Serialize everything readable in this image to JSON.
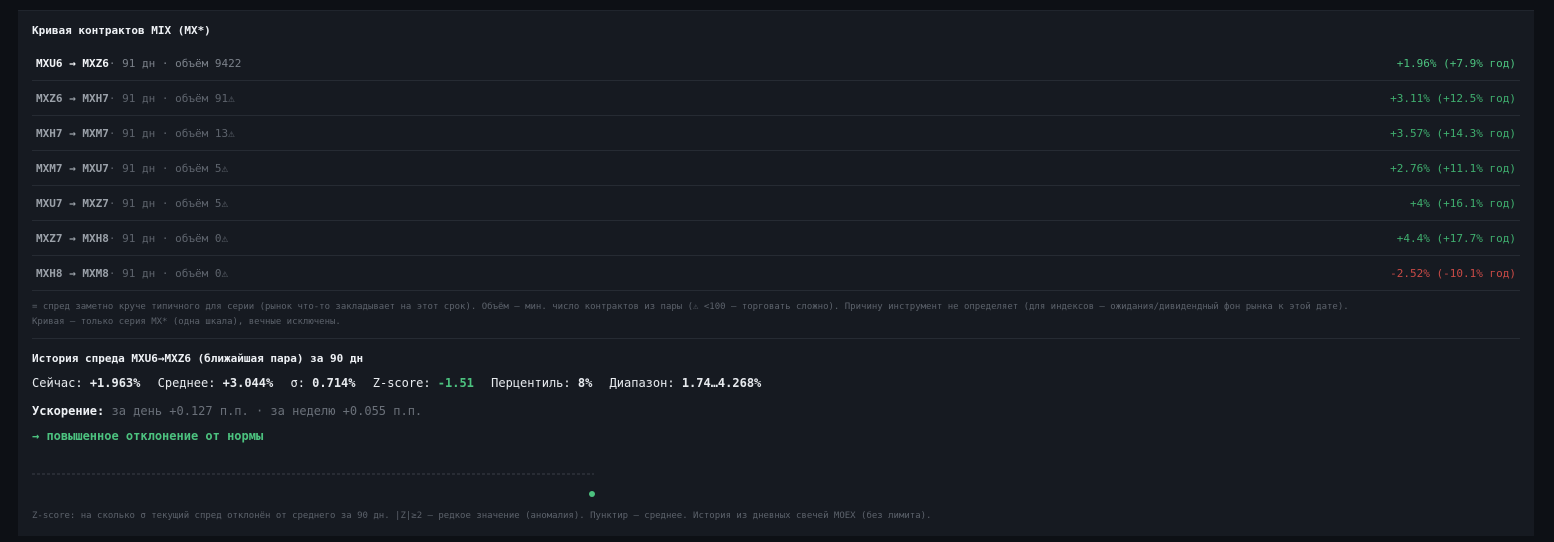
{
  "curve": {
    "title": "Кривая контрактов MIX (MX*)",
    "rows": [
      {
        "pair": "MXU6 → MXZ6",
        "meta": " · 91 дн · объём 9422",
        "pct": "+1.96% (+7.9% год)"
      },
      {
        "pair": "MXZ6 → MXH7",
        "meta": " · 91 дн · объём 91⚠",
        "pct": "+3.11% (+12.5% год)"
      },
      {
        "pair": "MXH7 → MXM7",
        "meta": " · 91 дн · объём 13⚠",
        "pct": "+3.57% (+14.3% год)"
      },
      {
        "pair": "MXM7 → MXU7",
        "meta": " · 91 дн · объём 5⚠",
        "pct": "+2.76% (+11.1% год)"
      },
      {
        "pair": "MXU7 → MXZ7",
        "meta": " · 91 дн · объём 5⚠",
        "pct": "+4% (+16.1% год)"
      },
      {
        "pair": "MXZ7 → MXH8",
        "meta": " · 91 дн · объём 0⚠",
        "pct": "+4.4% (+17.7% год)"
      },
      {
        "pair": "MXH8 → MXM8",
        "meta": " · 91 дн · объём 0⚠",
        "pct": "-2.52% (-10.1% год)"
      }
    ],
    "note_line1": "= спред заметно круче типичного для серии (рынок что-то закладывает на этот срок). Объём — мин. число контрактов из пары (⚠ <100 — торговать сложно). Причину инструмент не определяет (для индексов — ожидания/дивидендный фон рынка к этой дате).",
    "note_line2": "Кривая — только серия MX* (одна шкала), вечные исключены."
  },
  "history": {
    "title": "История спреда MXU6→MXZ6 (ближайшая пара) за 90 дн",
    "now_label": "Сейчас:",
    "now_value": "+1.963%",
    "mean_label": "Среднее:",
    "mean_value": "+3.044%",
    "sigma_label": "σ:",
    "sigma_value": "0.714%",
    "z_label": "Z-score:",
    "z_value": "-1.51",
    "pct_label": "Перцентиль:",
    "pct_value": "8%",
    "range_label": "Диапазон:",
    "range_value": "1.74…4.268%",
    "accel_label": "Ускорение:",
    "accel_value": "за день +0.127 п.п. · за неделю +0.055 п.п.",
    "verdict": "→ повышенное отклонение от нормы",
    "footnote": "Z-score: на сколько σ текущий спред отклонён от среднего за 90 дн. |Z|≥2 — редкое значение (аномалия). Пунктир — среднее. История из дневных свечей MOEX (без лимита)."
  },
  "chart_data": {
    "type": "line",
    "mean": 3.044,
    "points": [
      {
        "y": 1.963
      }
    ]
  },
  "colors": {
    "positive": "#4cc27f",
    "negative": "#c84a46",
    "background": "#161a21"
  }
}
